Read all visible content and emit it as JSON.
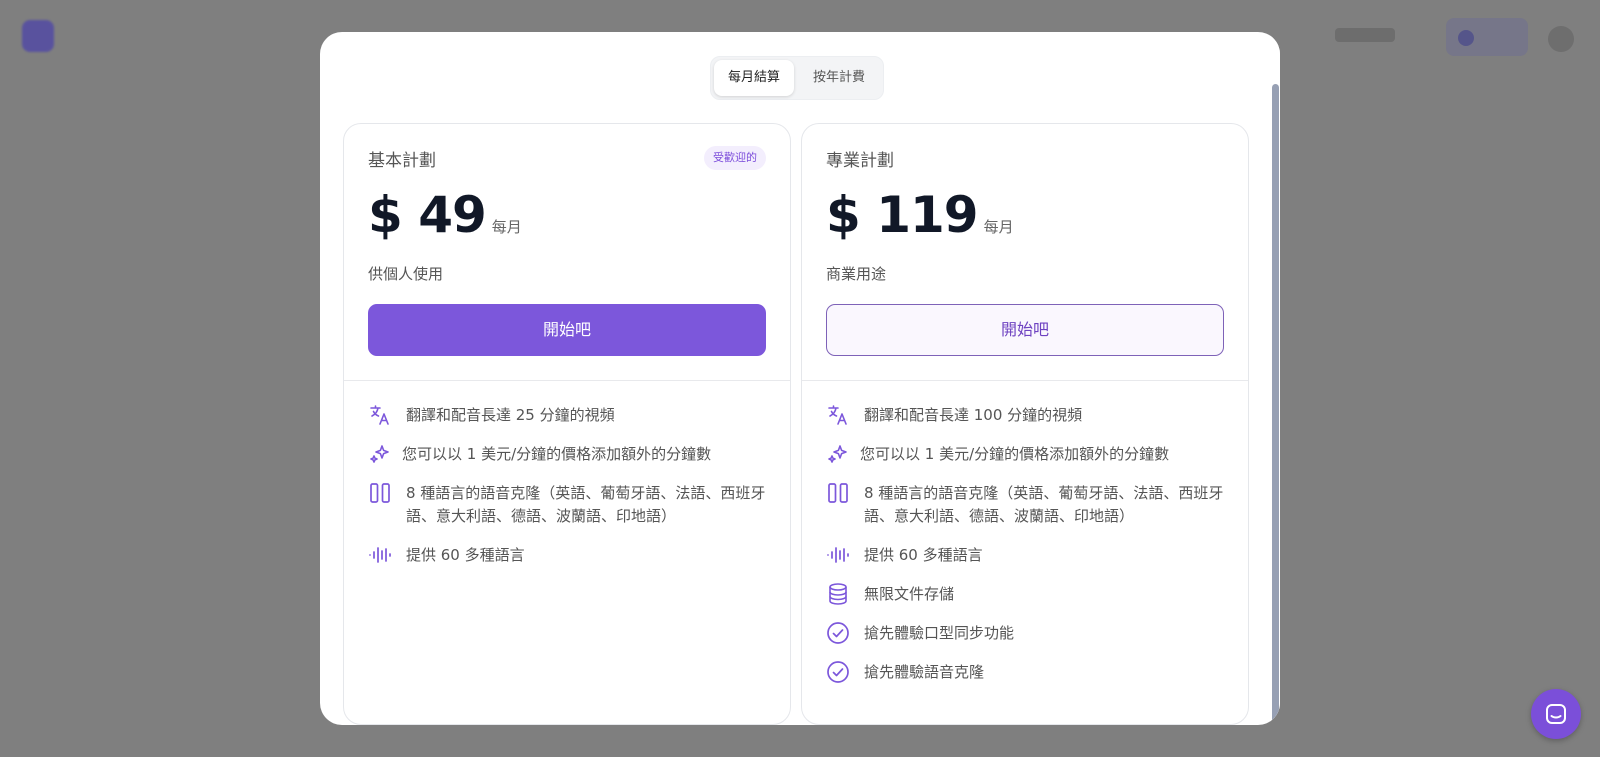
{
  "billing_toggle": {
    "monthly": "每月結算",
    "yearly": "按年計費"
  },
  "plans": [
    {
      "name": "基本計劃",
      "badge": "受歡迎的",
      "price": "$ 49",
      "period": "每月",
      "subtitle": "供個人使用",
      "cta": "開始吧",
      "features": [
        {
          "icon": "translate-icon",
          "text": "翻譯和配音長達 25 分鐘的視頻"
        },
        {
          "icon": "sparkles-icon",
          "text": "您可以以 1 美元/分鐘的價格添加額外的分鐘數"
        },
        {
          "icon": "columns-icon",
          "text": "8 種語言的語音克隆（英語、葡萄牙語、法語、西班牙語、意大利語、德語、波蘭語、印地語）"
        },
        {
          "icon": "audio-wave-icon",
          "text": "提供 60 多種語言"
        }
      ]
    },
    {
      "name": "專業計劃",
      "price": "$ 119",
      "period": "每月",
      "subtitle": "商業用途",
      "cta": "開始吧",
      "features": [
        {
          "icon": "translate-icon",
          "text": "翻譯和配音長達 100 分鐘的視頻"
        },
        {
          "icon": "sparkles-icon",
          "text": "您可以以 1 美元/分鐘的價格添加額外的分鐘數"
        },
        {
          "icon": "columns-icon",
          "text": "8 種語言的語音克隆（英語、葡萄牙語、法語、西班牙語、意大利語、德語、波蘭語、印地語）"
        },
        {
          "icon": "audio-wave-icon",
          "text": "提供 60 多種語言"
        },
        {
          "icon": "database-icon",
          "text": "無限文件存儲"
        },
        {
          "icon": "check-circle-icon",
          "text": "搶先體驗口型同步功能"
        },
        {
          "icon": "check-circle-icon",
          "text": "搶先體驗語音克隆"
        }
      ]
    }
  ],
  "colors": {
    "accent": "#7c57db",
    "badge_bg": "#f3eefd",
    "overlay": "#7f7f7f"
  }
}
